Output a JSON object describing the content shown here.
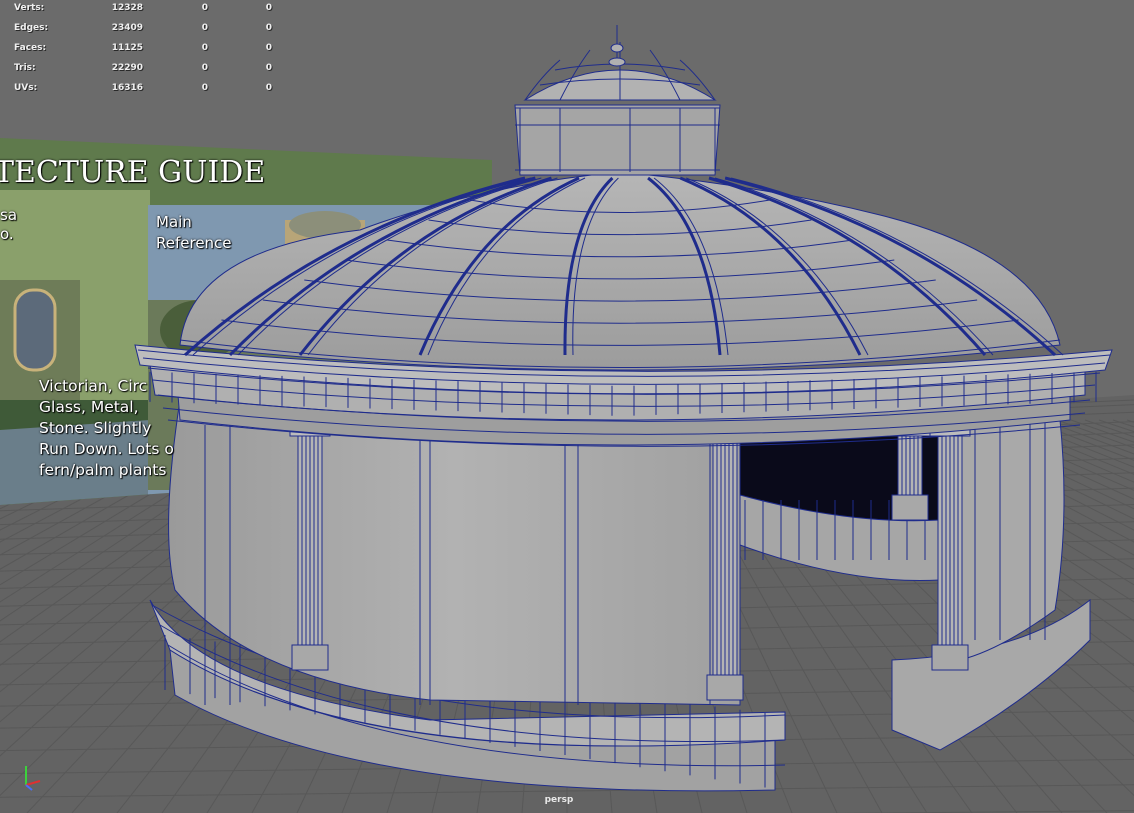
{
  "hud": {
    "rows": [
      {
        "label": "Verts:",
        "total": "12328",
        "selected": "0",
        "component": "0"
      },
      {
        "label": "Edges:",
        "total": "23409",
        "selected": "0",
        "component": "0"
      },
      {
        "label": "Faces:",
        "total": "11125",
        "selected": "0",
        "component": "0"
      },
      {
        "label": "Tris:",
        "total": "22290",
        "selected": "0",
        "component": "0"
      },
      {
        "label": "UVs:",
        "total": "16316",
        "selected": "0",
        "component": "0"
      }
    ]
  },
  "reference_board": {
    "title": "TECTURE GUIDE",
    "side_text": "sa\no.",
    "main_label": "Main\nReference",
    "description": "Victorian, Circ\nGlass, Metal,\nStone. Slightly\nRun Down. Lots o\nfern/palm plants"
  },
  "camera": {
    "name": "persp"
  },
  "colors": {
    "viewport_bg": "#676767",
    "grid_line": "#5a5a5a",
    "wireframe": "#1f2c8c",
    "surface": "#a8a8a8",
    "board_green": "#5f7a4c"
  },
  "icons": {
    "axis": "axis-gizmo-icon"
  }
}
